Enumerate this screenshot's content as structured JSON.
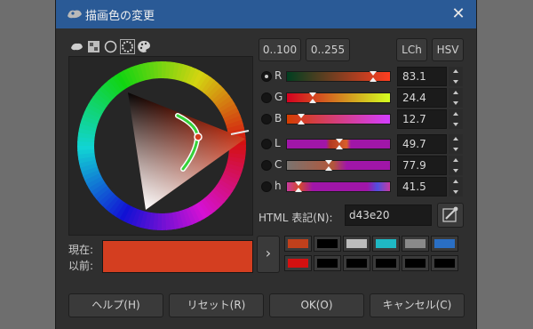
{
  "window": {
    "title": "描画色の変更",
    "close_glyph": "✕"
  },
  "icons": [
    "wilber-icon",
    "palette-icon",
    "watercolor-icon",
    "color-wheel-icon",
    "color-palette-icon"
  ],
  "mode_buttons": {
    "range_100": "0..100",
    "range_255": "0..255",
    "lch": "LCh",
    "hsv": "HSV"
  },
  "channels": [
    {
      "label": "R",
      "value": "83.1",
      "selected": true
    },
    {
      "label": "G",
      "value": "24.4",
      "selected": false
    },
    {
      "label": "B",
      "value": "12.7",
      "selected": false
    },
    {
      "label": "L",
      "value": "49.7",
      "selected": false
    },
    {
      "label": "C",
      "value": "77.9",
      "selected": false
    },
    {
      "label": "h",
      "value": "41.5",
      "selected": false
    }
  ],
  "html_notation": {
    "label": "HTML 表記(N):",
    "value": "d43e20"
  },
  "current_label": "現在:",
  "previous_label": "以前:",
  "current_color": "#d43e20",
  "history_colors": [
    [
      "#c0401c",
      "#000000",
      "#bcbcbc",
      "#1fb8c4",
      "#8a8a8a",
      "#2a6fc4"
    ],
    [
      "#d41010",
      "#000000",
      "#000000",
      "#000000",
      "#000000",
      "#000000"
    ]
  ],
  "buttons": {
    "help": "ヘルプ(H)",
    "reset": "リセット(R)",
    "ok": "OK(O)",
    "cancel": "キャンセル(C)"
  }
}
